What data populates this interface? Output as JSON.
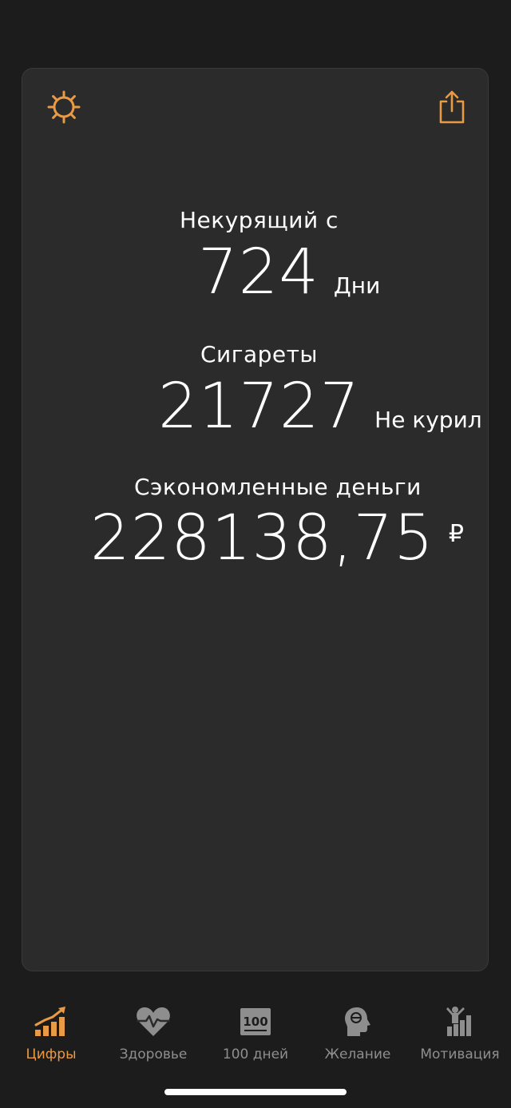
{
  "colors": {
    "accent": "#e89a45",
    "inactive": "#8e8e8e",
    "card_bg": "#2b2b2b",
    "screen_bg": "#1c1c1c"
  },
  "header": {
    "settings_icon": "gear-icon",
    "share_icon": "share-icon"
  },
  "stats": {
    "smoke_free_label": "Некурящий с",
    "days_value": "724",
    "days_unit": "Дни",
    "cigarettes_label": "Сигареты",
    "cigarettes_value": "21727",
    "cigarettes_unit": "Не курил",
    "money_label": "Сэкономленные деньги",
    "money_value": "228138,75",
    "money_currency": "₽"
  },
  "tabs": [
    {
      "label": "Цифры",
      "icon": "chart-growth-icon",
      "active": true
    },
    {
      "label": "Здоровье",
      "icon": "heart-pulse-icon",
      "active": false
    },
    {
      "label": "100 дней",
      "icon": "hundred-icon",
      "active": false
    },
    {
      "label": "Желание",
      "icon": "head-icon",
      "active": false
    },
    {
      "label": "Мотивация",
      "icon": "person-chart-icon",
      "active": false
    }
  ]
}
